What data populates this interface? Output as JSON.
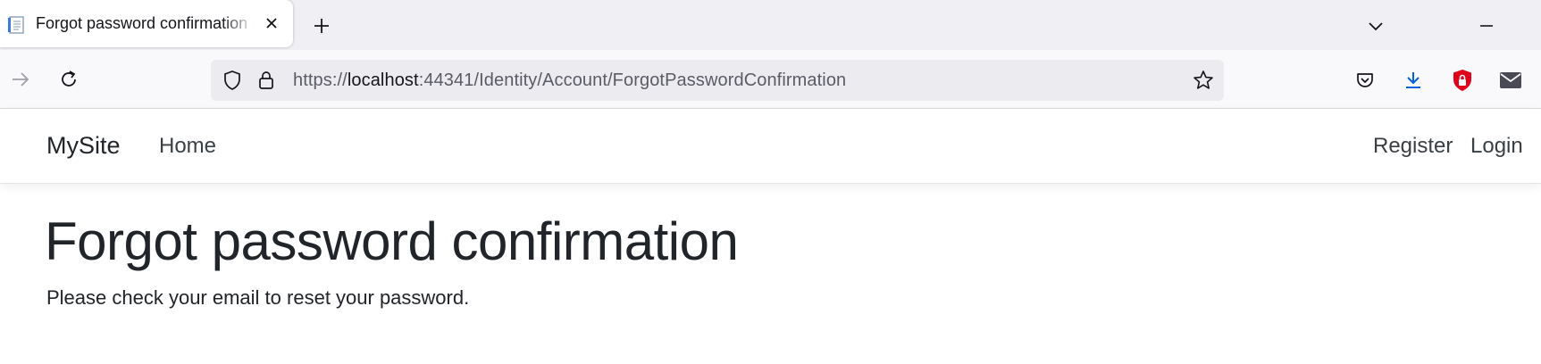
{
  "browser": {
    "tab": {
      "title": "Forgot password confirmation - MySite"
    },
    "url": {
      "scheme": "https://",
      "host": "localhost",
      "rest": ":44341/Identity/Account/ForgotPasswordConfirmation"
    }
  },
  "site": {
    "brand": "MySite",
    "nav": {
      "home": "Home",
      "register": "Register",
      "login": "Login"
    }
  },
  "main": {
    "title": "Forgot password confirmation",
    "message": "Please check your email to reset your password."
  },
  "colors": {
    "text": "#212529",
    "download_accent": "#0060df",
    "shield_red": "#e0001b"
  }
}
